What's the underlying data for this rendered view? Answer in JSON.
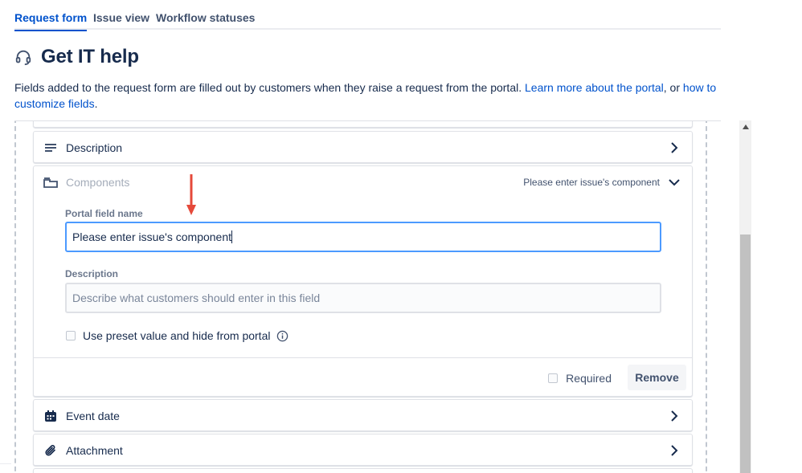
{
  "tabs": [
    {
      "label": "Request form",
      "active": true
    },
    {
      "label": "Issue view",
      "active": false
    },
    {
      "label": "Workflow statuses",
      "active": false
    }
  ],
  "page": {
    "icon": "headset-icon",
    "title": "Get IT help"
  },
  "intro": {
    "text_before": "Fields added to the request form are filled out by customers when they raise a request from the portal. ",
    "link1": "Learn more about the portal",
    "text_middle": ", or ",
    "link2": "how to customize fields",
    "text_after": "."
  },
  "fields": {
    "description": {
      "label": "Description",
      "icon": "text-lines-icon"
    },
    "components": {
      "label": "Components",
      "icon": "component-icon",
      "summary": "Please enter issue's component",
      "portal_field_label": "Portal field name",
      "portal_field_value": "Please enter issue's component",
      "description_label": "Description",
      "description_placeholder": "Describe what customers should enter in this field",
      "preset_label": "Use preset value and hide from portal",
      "required_label": "Required",
      "remove_label": "Remove"
    },
    "event_date": {
      "label": "Event date",
      "icon": "calendar-icon"
    },
    "attachment": {
      "label": "Attachment",
      "icon": "paperclip-icon"
    }
  },
  "colors": {
    "accent": "#0052cc",
    "focus": "#4c9aff",
    "annotation_arrow": "#e5493a"
  }
}
